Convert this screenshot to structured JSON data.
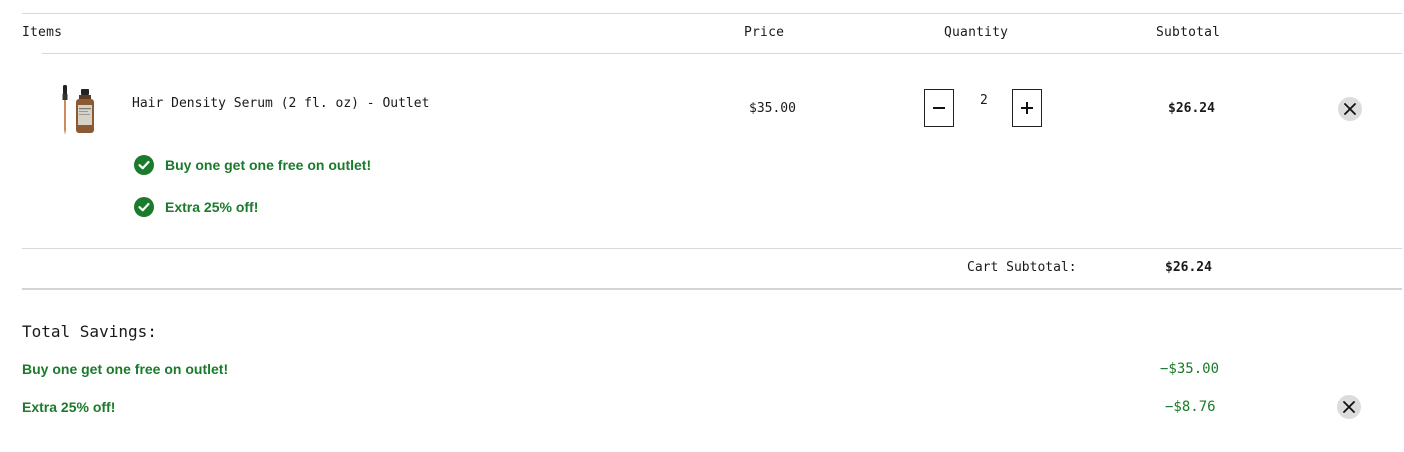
{
  "header": {
    "items": "Items",
    "price": "Price",
    "quantity": "Quantity",
    "subtotal": "Subtotal"
  },
  "line_item": {
    "name": "Hair Density Serum (2 fl. oz) - Outlet",
    "price": "$35.00",
    "quantity": "2",
    "subtotal": "$26.24",
    "promos": [
      "Buy one get one free on outlet!",
      "Extra 25% off!"
    ]
  },
  "cart": {
    "subtotal_label": "Cart Subtotal:",
    "subtotal_value": "$26.24"
  },
  "savings": {
    "title": "Total Savings:",
    "rows": [
      {
        "label": "Buy one get one free on outlet!",
        "amount": "−$35.00"
      },
      {
        "label": "Extra 25% off!",
        "amount": "−$8.76"
      }
    ]
  },
  "icons": {
    "check": "check-circle-icon",
    "minus": "minus-icon",
    "plus": "plus-icon",
    "close": "close-icon"
  },
  "colors": {
    "promo_green": "#1b7a2c",
    "remove_bg": "#dcdcdc"
  }
}
